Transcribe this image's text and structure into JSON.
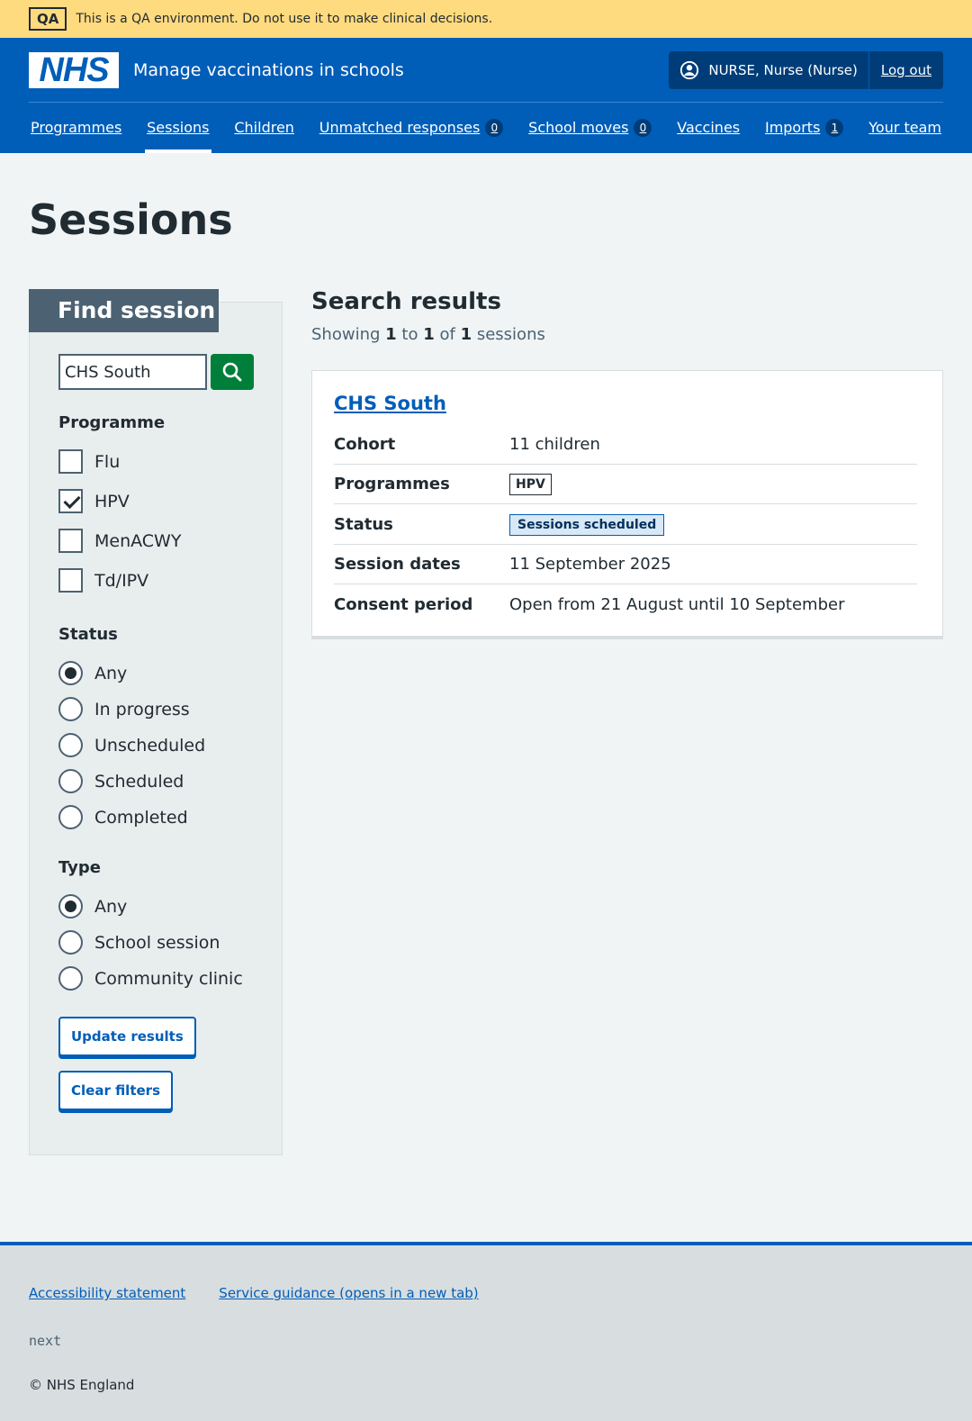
{
  "qa_banner": {
    "tag": "QA",
    "message": "This is a QA environment. Do not use it to make clinical decisions."
  },
  "header": {
    "logo_text": "NHS",
    "service_name": "Manage vaccinations in schools",
    "user_label": "NURSE, Nurse (Nurse)",
    "logout_label": "Log out"
  },
  "nav": {
    "programmes": "Programmes",
    "sessions": "Sessions",
    "children": "Children",
    "unmatched": "Unmatched responses",
    "unmatched_count": "0",
    "school_moves": "School moves",
    "school_moves_count": "0",
    "vaccines": "Vaccines",
    "imports": "Imports",
    "imports_count": "1",
    "your_team": "Your team"
  },
  "page": {
    "title": "Sessions"
  },
  "filters": {
    "heading": "Find session",
    "search_value": "CHS South",
    "programme_label": "Programme",
    "programmes": [
      "Flu",
      "HPV",
      "MenACWY",
      "Td/IPV"
    ],
    "programmes_checked": [
      false,
      true,
      false,
      false
    ],
    "status_label": "Status",
    "statuses": [
      "Any",
      "In progress",
      "Unscheduled",
      "Scheduled",
      "Completed"
    ],
    "status_selected": "Any",
    "type_label": "Type",
    "types": [
      "Any",
      "School session",
      "Community clinic"
    ],
    "type_selected": "Any",
    "update_label": "Update results",
    "clear_label": "Clear filters"
  },
  "results": {
    "title": "Search results",
    "showing": "Showing",
    "from": "1",
    "to_word": "to",
    "to": "1",
    "of_word": "of",
    "total": "1",
    "unit": "sessions",
    "session": {
      "name": "CHS South",
      "cohort_label": "Cohort",
      "cohort_value": "11 children",
      "programmes_label": "Programmes",
      "programme_tag": "HPV",
      "status_label": "Status",
      "status_tag": "Sessions scheduled",
      "dates_label": "Session dates",
      "dates_value": "11 September 2025",
      "consent_label": "Consent period",
      "consent_value": "Open from 21 August until 10 September"
    }
  },
  "footer": {
    "accessibility": "Accessibility statement",
    "guidance": "Service guidance (opens in a new tab)",
    "version": "next",
    "copyright": "© NHS England"
  },
  "colors": {
    "nhs_blue": "#005eb8",
    "qa_yellow": "#ffdb7f",
    "search_green": "#007f3b",
    "panel_heading": "#4c6272"
  }
}
